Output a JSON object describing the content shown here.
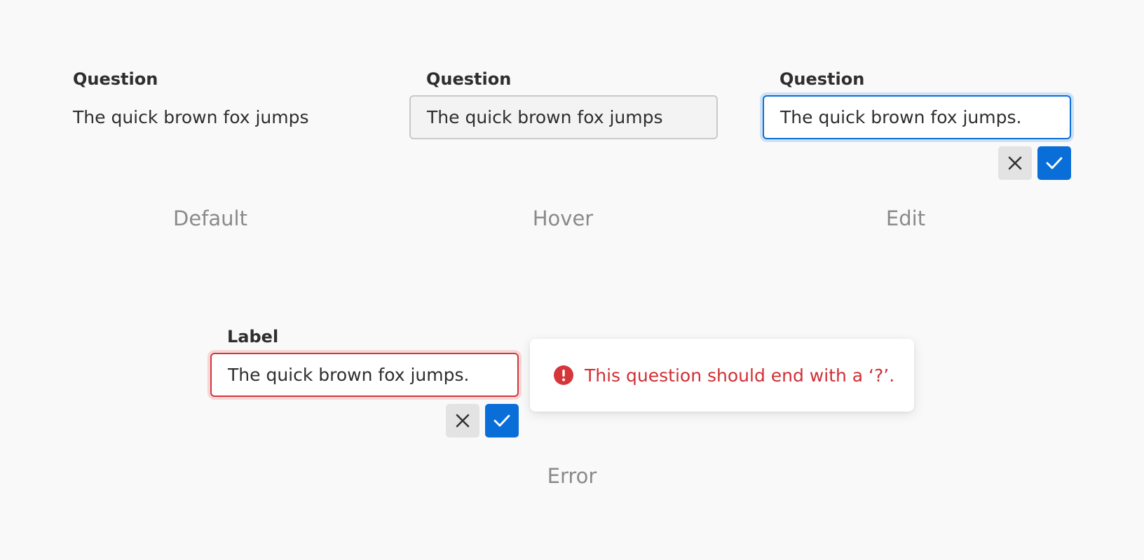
{
  "states": {
    "default": {
      "label": "Question",
      "value": "The quick brown fox jumps",
      "caption": "Default"
    },
    "hover": {
      "label": "Question",
      "value": "The quick brown fox jumps",
      "caption": "Hover"
    },
    "edit": {
      "label": "Question",
      "value": "The quick brown fox jumps.",
      "caption": "Edit"
    },
    "error": {
      "label": "Label",
      "value": "The quick brown fox jumps.",
      "message": "This question should end with a ‘?’.",
      "caption": "Error"
    }
  },
  "icons": {
    "cancel": "close-icon",
    "confirm": "check-icon",
    "error": "error-circle-icon"
  },
  "colors": {
    "background": "#f9f9f9",
    "accent": "#0a6ed8",
    "accent_ring": "#cfe1f5",
    "error": "#d6353a",
    "error_ring": "#f6d7d8",
    "hover_fill": "#f3f3f3",
    "caption": "#8a8a8a"
  }
}
